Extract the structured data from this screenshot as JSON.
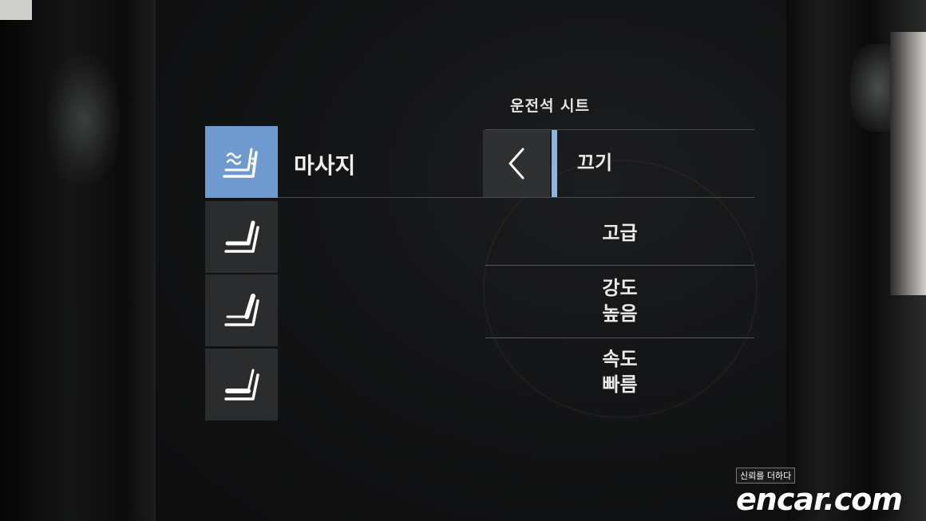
{
  "header": {
    "title": "운전석 시트"
  },
  "menu": {
    "massage_label": "마사지"
  },
  "seat_tiles": [
    {
      "icon": "massage-seat-icon",
      "active": true
    },
    {
      "icon": "seat-cushion-icon",
      "active": false
    },
    {
      "icon": "seat-backrest-icon",
      "active": false
    },
    {
      "icon": "seat-heat-icon",
      "active": false
    }
  ],
  "options": {
    "off": "끄기",
    "premium": "고급",
    "intensity_line1": "강도",
    "intensity_line2": "높음",
    "speed_line1": "속도",
    "speed_line2": "빠름"
  },
  "watermark": {
    "tagline": "신뢰를 더하다",
    "brand": "encar.com"
  },
  "colors": {
    "accent": "#6f9ad0",
    "selection": "#8ab6e6",
    "tile": "#2b2c2e",
    "text": "#ebebeb"
  }
}
